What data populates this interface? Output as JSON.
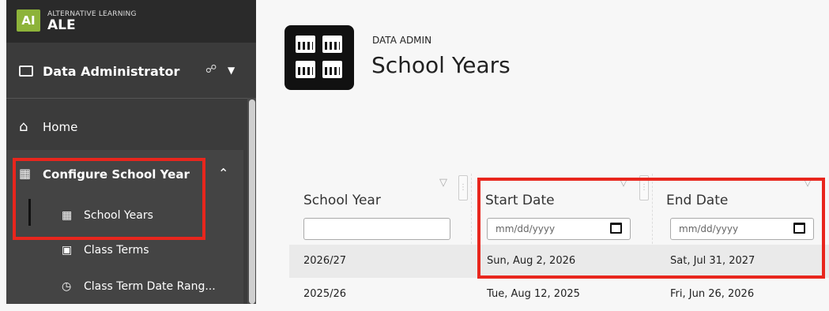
{
  "brand": {
    "logo_text": "AI",
    "subtitle": "ALTERNATIVE LEARNING",
    "name": "ALE"
  },
  "role": {
    "label": "Data Administrator",
    "icon": "id-card-icon"
  },
  "nav": {
    "home": {
      "label": "Home",
      "icon": "home-icon"
    },
    "configure": {
      "label": "Configure School Year",
      "icon": "calendar-icon",
      "expanded": true
    },
    "sub_items": [
      {
        "label": "School Years",
        "icon": "calendar-grid-icon",
        "active": true
      },
      {
        "label": "Class Terms",
        "icon": "monitor-icon",
        "active": false
      },
      {
        "label": "Class Term Date Rang...",
        "icon": "calendar-clock-icon",
        "active": false
      }
    ]
  },
  "header": {
    "section": "DATA ADMIN",
    "title": "School Years"
  },
  "grid": {
    "columns": [
      "School Year",
      "Start Date",
      "End Date"
    ],
    "date_placeholder": "mm/dd/yyyy",
    "rows": [
      {
        "school_year": "2026/27",
        "start_date": "Sun, Aug 2, 2026",
        "end_date": "Sat, Jul 31, 2027"
      },
      {
        "school_year": "2025/26",
        "start_date": "Tue, Aug 12, 2025",
        "end_date": "Fri, Jun 26, 2026"
      }
    ]
  },
  "colors": {
    "highlight": "#e8261d",
    "sidebar_bg": "#3b3b3b",
    "logo_green": "#8db33a"
  }
}
